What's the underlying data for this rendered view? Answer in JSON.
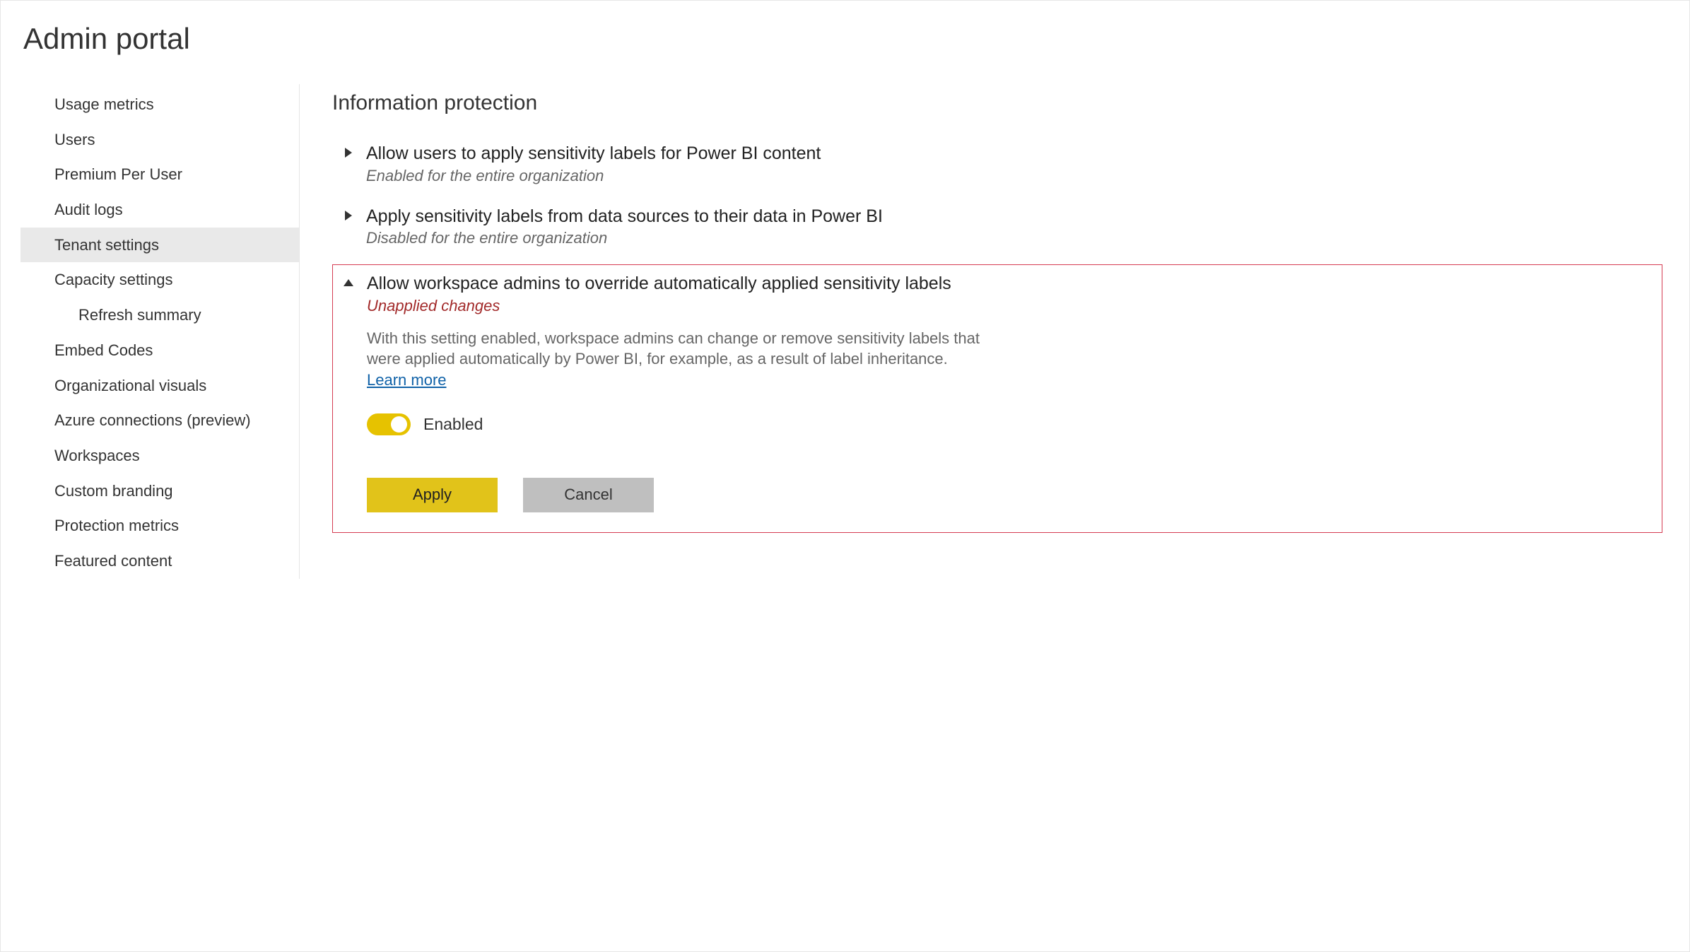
{
  "header": {
    "title": "Admin portal"
  },
  "sidebar": {
    "items": [
      {
        "label": "Usage metrics",
        "selected": false,
        "indent": false
      },
      {
        "label": "Users",
        "selected": false,
        "indent": false
      },
      {
        "label": "Premium Per User",
        "selected": false,
        "indent": false
      },
      {
        "label": "Audit logs",
        "selected": false,
        "indent": false
      },
      {
        "label": "Tenant settings",
        "selected": true,
        "indent": false
      },
      {
        "label": "Capacity settings",
        "selected": false,
        "indent": false
      },
      {
        "label": "Refresh summary",
        "selected": false,
        "indent": true
      },
      {
        "label": "Embed Codes",
        "selected": false,
        "indent": false
      },
      {
        "label": "Organizational visuals",
        "selected": false,
        "indent": false
      },
      {
        "label": "Azure connections (preview)",
        "selected": false,
        "indent": false
      },
      {
        "label": "Workspaces",
        "selected": false,
        "indent": false
      },
      {
        "label": "Custom branding",
        "selected": false,
        "indent": false
      },
      {
        "label": "Protection metrics",
        "selected": false,
        "indent": false
      },
      {
        "label": "Featured content",
        "selected": false,
        "indent": false
      }
    ]
  },
  "main": {
    "section_title": "Information protection",
    "settings": [
      {
        "expanded": false,
        "title": "Allow users to apply sensitivity labels for Power BI content",
        "status": "Enabled for the entire organization"
      },
      {
        "expanded": false,
        "title": "Apply sensitivity labels from data sources to their data in Power BI",
        "status": "Disabled for the entire organization"
      },
      {
        "expanded": true,
        "highlighted": true,
        "title": "Allow workspace admins to override automatically applied sensitivity labels",
        "status": "Unapplied changes",
        "status_warn": true,
        "description": "With this setting enabled, workspace admins can change or remove sensitivity labels that were applied automatically by Power BI, for example, as a result of label inheritance.",
        "learn_more": "Learn more",
        "toggle_on": true,
        "toggle_label": "Enabled",
        "apply_label": "Apply",
        "cancel_label": "Cancel"
      }
    ]
  }
}
